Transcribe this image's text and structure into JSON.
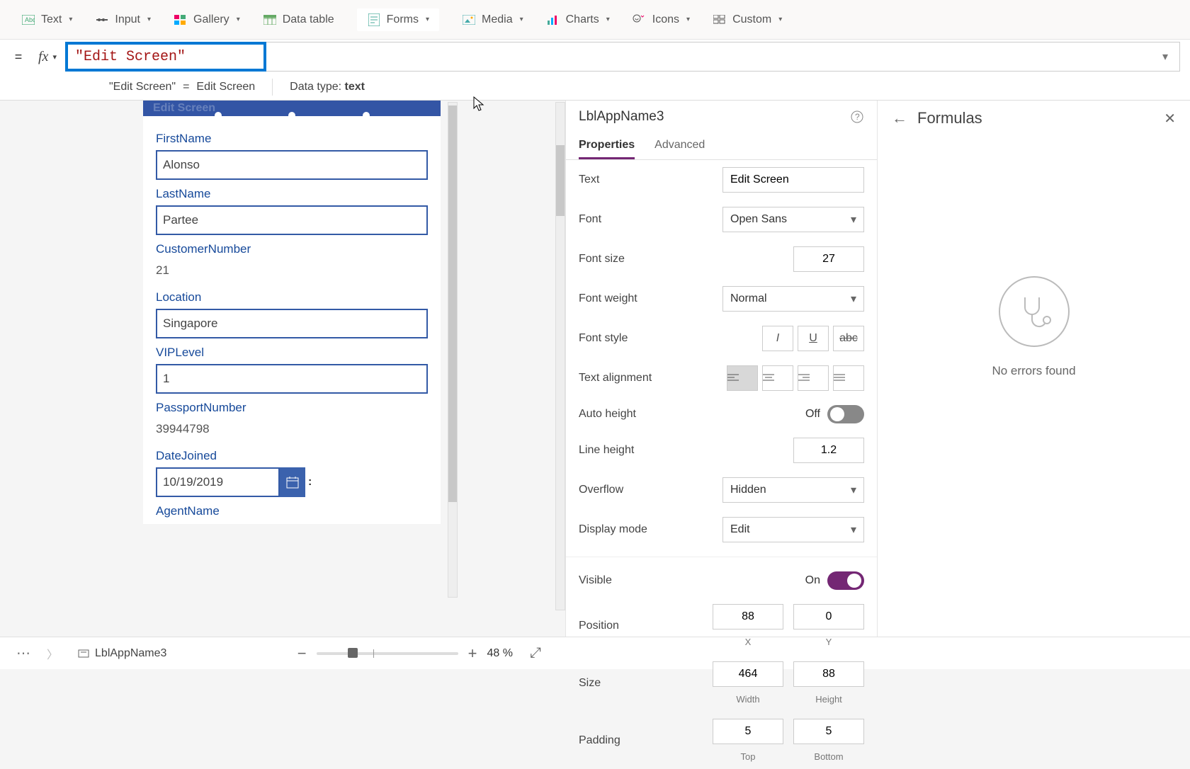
{
  "ribbon": {
    "items": [
      {
        "label": "Text",
        "icon": "text-icon"
      },
      {
        "label": "Input",
        "icon": "input-icon"
      },
      {
        "label": "Gallery",
        "icon": "gallery-icon"
      },
      {
        "label": "Data table",
        "icon": "datatable-icon"
      },
      {
        "label": "Forms",
        "icon": "forms-icon"
      },
      {
        "label": "Media",
        "icon": "media-icon"
      },
      {
        "label": "Charts",
        "icon": "charts-icon"
      },
      {
        "label": "Icons",
        "icon": "icons-icon"
      },
      {
        "label": "Custom",
        "icon": "custom-icon"
      }
    ]
  },
  "formula_bar": {
    "fx_label": "fx",
    "value": "\"Edit Screen\"",
    "evaluation_left": "\"Edit Screen\"",
    "equals": "=",
    "evaluation_right": "Edit Screen",
    "datatype_label": "Data type:",
    "datatype_value": "text"
  },
  "canvas": {
    "header_text": "Edit Screen",
    "fields": [
      {
        "label": "FirstName",
        "type": "text",
        "value": "Alonso"
      },
      {
        "label": "LastName",
        "type": "text",
        "value": "Partee"
      },
      {
        "label": "CustomerNumber",
        "type": "static",
        "value": "21"
      },
      {
        "label": "Location",
        "type": "text",
        "value": "Singapore"
      },
      {
        "label": "VIPLevel",
        "type": "text",
        "value": "1"
      },
      {
        "label": "PassportNumber",
        "type": "static",
        "value": "39944798"
      },
      {
        "label": "DateJoined",
        "type": "date",
        "value": "10/19/2019"
      },
      {
        "label": "AgentName",
        "type": "label",
        "value": ""
      }
    ]
  },
  "properties_panel": {
    "title": "LblAppName3",
    "tabs": {
      "properties": "Properties",
      "advanced": "Advanced"
    },
    "rows": {
      "text": {
        "label": "Text",
        "value": "Edit Screen"
      },
      "font": {
        "label": "Font",
        "value": "Open Sans"
      },
      "font_size": {
        "label": "Font size",
        "value": "27"
      },
      "font_weight": {
        "label": "Font weight",
        "value": "Normal"
      },
      "font_style": {
        "label": "Font style",
        "italic": "I",
        "underline": "U",
        "strike": "abc"
      },
      "text_align": {
        "label": "Text alignment"
      },
      "auto_height": {
        "label": "Auto height",
        "state_label": "Off"
      },
      "line_height": {
        "label": "Line height",
        "value": "1.2"
      },
      "overflow": {
        "label": "Overflow",
        "value": "Hidden"
      },
      "display_mode": {
        "label": "Display mode",
        "value": "Edit"
      },
      "visible": {
        "label": "Visible",
        "state_label": "On"
      },
      "position": {
        "label": "Position",
        "x": "88",
        "y": "0",
        "x_sub": "X",
        "y_sub": "Y"
      },
      "size": {
        "label": "Size",
        "w": "464",
        "h": "88",
        "w_sub": "Width",
        "h_sub": "Height"
      },
      "padding": {
        "label": "Padding",
        "top": "5",
        "bottom": "5",
        "top_sub": "Top",
        "bottom_sub": "Bottom"
      }
    }
  },
  "formulas_panel": {
    "title": "Formulas",
    "empty_message": "No errors found"
  },
  "status_bar": {
    "breadcrumb": "LblAppName3",
    "zoom": {
      "percent": "48",
      "suffix": "%"
    }
  }
}
